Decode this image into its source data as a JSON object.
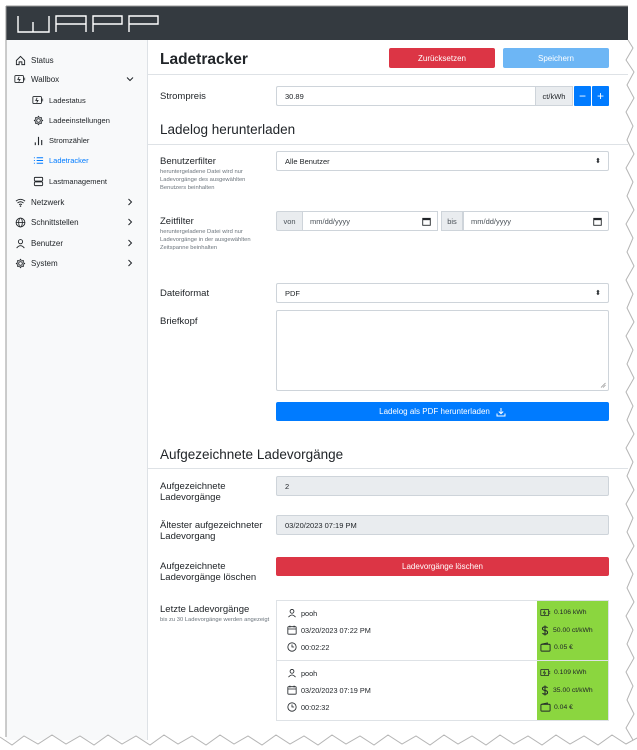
{
  "header": {
    "logo_text": "WARP"
  },
  "sidebar": {
    "items": [
      {
        "label": "Status",
        "icon": "home-icon"
      },
      {
        "label": "Wallbox",
        "icon": "charger-icon"
      },
      {
        "label": "Ladestatus",
        "icon": "charger-icon"
      },
      {
        "label": "Ladeeinstellungen",
        "icon": "gear-icon"
      },
      {
        "label": "Stromzähler",
        "icon": "bar-chart-icon"
      },
      {
        "label": "Ladetracker",
        "icon": "list-icon"
      },
      {
        "label": "Lastmanagement",
        "icon": "server-icon"
      },
      {
        "label": "Netzwerk",
        "icon": "wifi-icon"
      },
      {
        "label": "Schnittstellen",
        "icon": "globe-icon"
      },
      {
        "label": "Benutzer",
        "icon": "user-icon"
      },
      {
        "label": "System",
        "icon": "gear-icon"
      }
    ]
  },
  "page": {
    "title": "Ladetracker",
    "reset_label": "Zurücksetzen",
    "save_label": "Speichern"
  },
  "price": {
    "label": "Strompreis",
    "value": "30.89",
    "unit": "ct/kWh"
  },
  "download": {
    "section_title": "Ladelog herunterladen",
    "user_filter": {
      "label": "Benutzerfilter",
      "hint": "heruntergeladene Datei wird nur Ladevorgänge des ausgewählten Benutzers beinhalten",
      "value": "Alle Benutzer"
    },
    "time_filter": {
      "label": "Zeitfilter",
      "hint": "heruntergeladene Datei wird nur Ladevorgänge in der ausgewählten Zeitspanne beinhalten",
      "from_label": "von",
      "from_placeholder": "mm/dd/yyyy",
      "to_label": "bis",
      "to_placeholder": "mm/dd/yyyy"
    },
    "file_format": {
      "label": "Dateiformat",
      "value": "PDF"
    },
    "letterhead": {
      "label": "Briefkopf",
      "value": ""
    },
    "button_label": "Ladelog als PDF herunterladen"
  },
  "recorded": {
    "section_title": "Aufgezeichnete Ladevorgänge",
    "count_label": "Aufgezeichnete Ladevorgänge",
    "count_value": "2",
    "oldest_label": "Ältester aufgezeichneter Ladevorgang",
    "oldest_value": "03/20/2023 07:19 PM",
    "delete_label": "Aufgezeichnete Ladevorgänge löschen",
    "delete_button": "Ladevorgänge löschen",
    "last_label": "Letzte Ladevorgänge",
    "last_hint": "bis zu 30 Ladevorgänge werden angezeigt",
    "sessions": [
      {
        "user": "pooh",
        "date": "03/20/2023 07:22 PM",
        "duration": "00:02:22",
        "energy": "0.106 kWh",
        "price": "50.00 ct/kWh",
        "cost": "0.05 €"
      },
      {
        "user": "pooh",
        "date": "03/20/2023 07:19 PM",
        "duration": "00:02:32",
        "energy": "0.109 kWh",
        "price": "35.00 ct/kWh",
        "cost": "0.04 €"
      }
    ]
  },
  "colors": {
    "primary": "#007bff",
    "danger": "#dc3545",
    "save_disabled": "#6db6f5",
    "highlight": "#8bd63f",
    "header": "#343a40"
  }
}
